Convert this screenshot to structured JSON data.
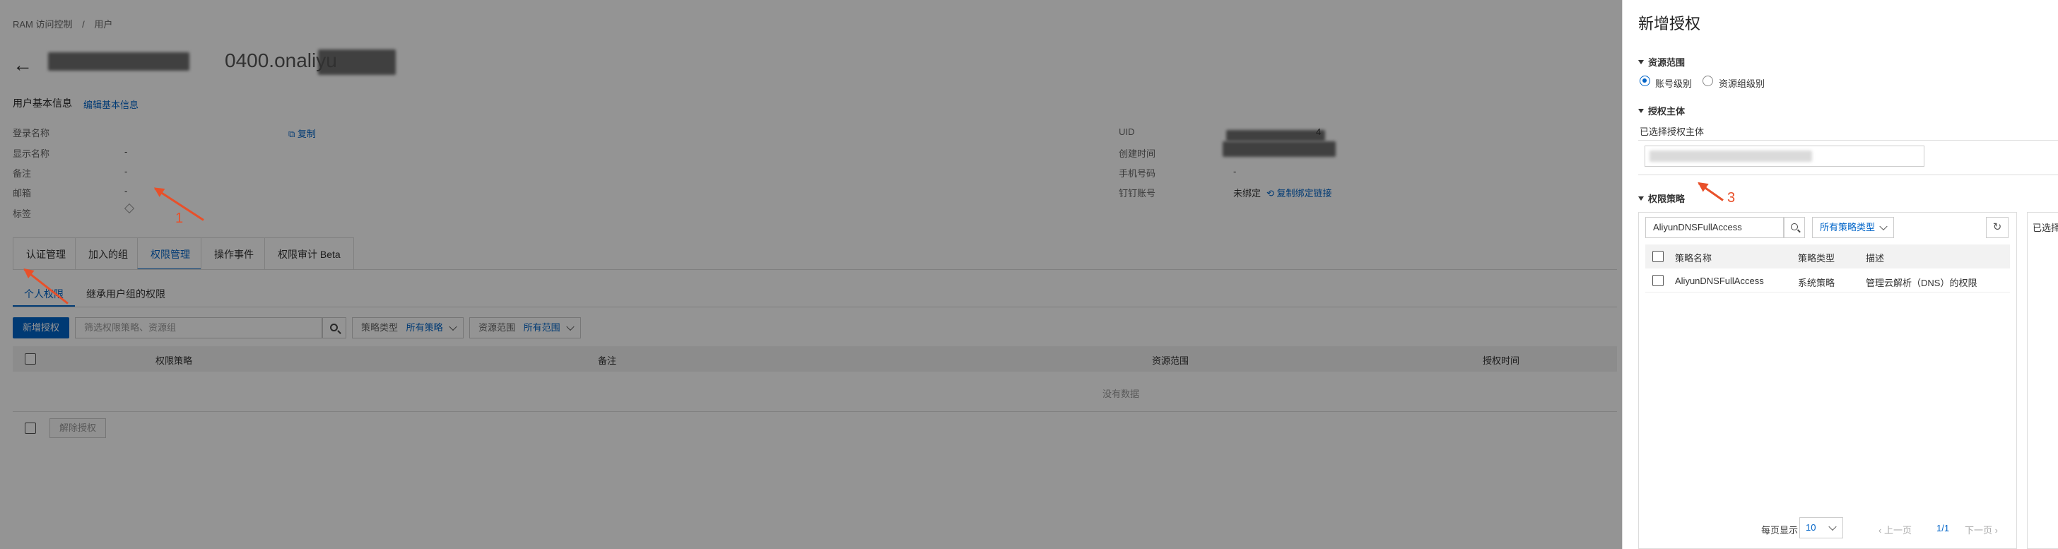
{
  "breadcrumb": {
    "root": "RAM 访问控制",
    "sep": "/",
    "current": "用户"
  },
  "user_header": {
    "title_suffix": "0400.onaliyu"
  },
  "basic_info": {
    "title": "用户基本信息",
    "edit_link": "编辑基本信息",
    "left_fields": [
      {
        "label": "登录名称",
        "value": ""
      },
      {
        "label": "显示名称",
        "value": "-"
      },
      {
        "label": "备注",
        "value": "-"
      },
      {
        "label": "邮箱",
        "value": "-"
      },
      {
        "label": "标签",
        "value": ""
      }
    ],
    "copy_link": "复制",
    "right_fields": [
      {
        "label": "UID",
        "value": "4"
      },
      {
        "label": "创建时间",
        "value": ""
      },
      {
        "label": "手机号码",
        "value": "-"
      },
      {
        "label": "钉钉账号",
        "value": "未绑定"
      }
    ],
    "copy_bind_link": "复制绑定链接"
  },
  "tabs": [
    "认证管理",
    "加入的组",
    "权限管理",
    "操作事件",
    "权限审计 Beta"
  ],
  "subtabs": [
    "个人权限",
    "继承用户组的权限"
  ],
  "toolbar": {
    "add_button": "新增授权",
    "search_placeholder": "筛选权限策略、资源组",
    "policy_type_label": "策略类型",
    "policy_type_value": "所有策略",
    "scope_label": "资源范围",
    "scope_value": "所有范围"
  },
  "table": {
    "columns": [
      "权限策略",
      "备注",
      "资源范围",
      "授权时间"
    ],
    "empty_text": "没有数据",
    "revoke_button": "解除授权"
  },
  "annotations": {
    "step1": "1",
    "step3": "3"
  },
  "panel": {
    "title": "新增授权",
    "scope_section": "资源范围",
    "scope_options": [
      "账号级别",
      "资源组级别"
    ],
    "principal_section": "授权主体",
    "principal_selected_label": "已选择授权主体",
    "policy_section": "权限策略",
    "search_value": "AliyunDNSFullAccess",
    "type_filter": "所有策略类型",
    "columns": [
      "策略名称",
      "策略类型",
      "描述"
    ],
    "rows": [
      {
        "name": "AliyunDNSFullAccess",
        "type": "系统策略",
        "desc": "管理云解析（DNS）的权限"
      }
    ],
    "pagination": {
      "per_page_label": "每页显示",
      "per_page": "10",
      "prev": "上一页",
      "page": "1/1",
      "next": "下一页"
    },
    "selected_header": "已选择"
  }
}
